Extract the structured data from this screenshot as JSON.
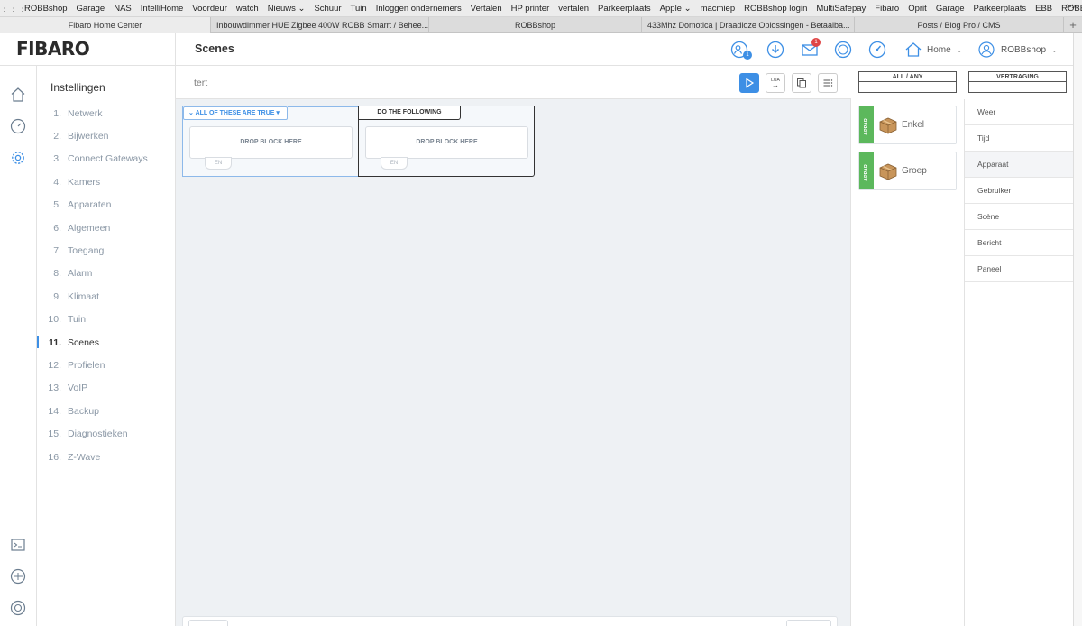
{
  "bookmarks": {
    "items": [
      "ROBBshop",
      "Garage",
      "NAS",
      "IntelliHome",
      "Voordeur",
      "watch",
      "Nieuws ⌄",
      "Schuur",
      "Tuin",
      "Inloggen ondernemers",
      "Vertalen",
      "HP printer",
      "vertalen",
      "Parkeerplaats",
      "Apple ⌄",
      "macmiep",
      "ROBBshop login",
      "MultiSafepay",
      "Fibaro",
      "Oprit",
      "Garage",
      "Parkeerplaats",
      "EBB",
      "ROBBshop"
    ],
    "more": ">>"
  },
  "tabs": [
    {
      "label": "Fibaro Home Center",
      "active": true
    },
    {
      "label": "Inbouwdimmer HUE Zigbee 400W ROBB Smarrt / Behee...",
      "active": false
    },
    {
      "label": "ROBBshop",
      "active": false
    },
    {
      "label": "433Mhz Domotica | Draadloze Oplossingen - Betaalba...",
      "active": false
    },
    {
      "label": "Posts / Blog Pro / CMS",
      "active": false
    }
  ],
  "tab_add": "+",
  "header": {
    "logo": "FIBARO",
    "title": "Scenes",
    "users_badge": "1",
    "mail_badge": "1",
    "home_label": "Home",
    "user_label": "ROBBshop"
  },
  "settings": {
    "title": "Instellingen",
    "items": [
      {
        "num": "1.",
        "label": "Netwerk"
      },
      {
        "num": "2.",
        "label": "Bijwerken"
      },
      {
        "num": "3.",
        "label": "Connect Gateways"
      },
      {
        "num": "4.",
        "label": "Kamers"
      },
      {
        "num": "5.",
        "label": "Apparaten"
      },
      {
        "num": "6.",
        "label": "Algemeen"
      },
      {
        "num": "7.",
        "label": "Toegang"
      },
      {
        "num": "8.",
        "label": "Alarm"
      },
      {
        "num": "9.",
        "label": "Klimaat"
      },
      {
        "num": "10.",
        "label": "Tuin"
      },
      {
        "num": "11.",
        "label": "Scenes"
      },
      {
        "num": "12.",
        "label": "Profielen"
      },
      {
        "num": "13.",
        "label": "VoIP"
      },
      {
        "num": "14.",
        "label": "Backup"
      },
      {
        "num": "15.",
        "label": "Diagnostieken"
      },
      {
        "num": "16.",
        "label": "Z-Wave"
      }
    ],
    "active_index": 10
  },
  "toolbar": {
    "scene_name": "tert",
    "lua_label": "LUA"
  },
  "canvas": {
    "condition_header": "ALL OF THESE ARE TRUE",
    "action_header": "DO THE FOLLOWING",
    "drop_label": "DROP BLOCK HERE",
    "en_label": "EN"
  },
  "palette": {
    "all_any_label": "ALL / ANY",
    "delay_label": "VERTRAGING",
    "blocks": [
      {
        "strip": "APPAR...",
        "label": "Enkel"
      },
      {
        "strip": "APPAR...",
        "label": "Groep"
      }
    ]
  },
  "categories": {
    "items": [
      "Weer",
      "Tijd",
      "Apparaat",
      "Gebruiker",
      "Scène",
      "Bericht",
      "Paneel"
    ],
    "active_index": 2
  },
  "colors": {
    "accent": "#3d8fe5",
    "badge": "#e04545",
    "device_green": "#5cb85c"
  }
}
